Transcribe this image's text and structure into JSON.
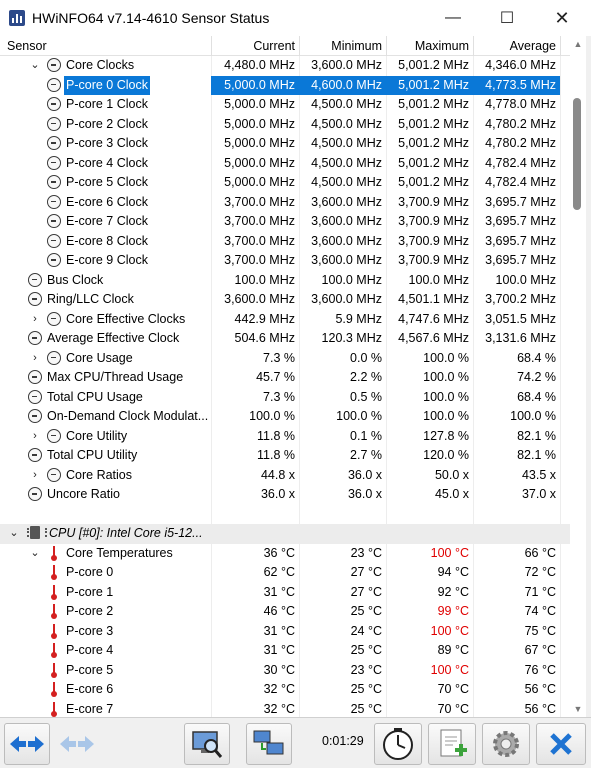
{
  "window": {
    "title": "HWiNFO64 v7.14-4610 Sensor Status"
  },
  "controls": {
    "minimize": "—",
    "maximize": "☐",
    "close": "✕"
  },
  "columns": {
    "sensor": "Sensor",
    "current": "Current",
    "minimum": "Minimum",
    "maximum": "Maximum",
    "average": "Average"
  },
  "rows": [
    {
      "label": "Core Clocks",
      "indent": 1,
      "expander": "⌄",
      "icon": "clock",
      "current": "4,480.0 MHz",
      "minimum": "3,600.0 MHz",
      "maximum": "5,001.2 MHz",
      "average": "4,346.0 MHz"
    },
    {
      "label": "P-core 0 Clock",
      "indent": 2,
      "icon": "clock",
      "selected": true,
      "current": "5,000.0 MHz",
      "minimum": "4,600.0 MHz",
      "maximum": "5,001.2 MHz",
      "average": "4,773.5 MHz"
    },
    {
      "label": "P-core 1 Clock",
      "indent": 2,
      "icon": "clock",
      "current": "5,000.0 MHz",
      "minimum": "4,500.0 MHz",
      "maximum": "5,001.2 MHz",
      "average": "4,778.0 MHz"
    },
    {
      "label": "P-core 2 Clock",
      "indent": 2,
      "icon": "clock",
      "current": "5,000.0 MHz",
      "minimum": "4,500.0 MHz",
      "maximum": "5,001.2 MHz",
      "average": "4,780.2 MHz"
    },
    {
      "label": "P-core 3 Clock",
      "indent": 2,
      "icon": "clock",
      "current": "5,000.0 MHz",
      "minimum": "4,500.0 MHz",
      "maximum": "5,001.2 MHz",
      "average": "4,780.2 MHz"
    },
    {
      "label": "P-core 4 Clock",
      "indent": 2,
      "icon": "clock",
      "current": "5,000.0 MHz",
      "minimum": "4,500.0 MHz",
      "maximum": "5,001.2 MHz",
      "average": "4,782.4 MHz"
    },
    {
      "label": "P-core 5 Clock",
      "indent": 2,
      "icon": "clock",
      "current": "5,000.0 MHz",
      "minimum": "4,500.0 MHz",
      "maximum": "5,001.2 MHz",
      "average": "4,782.4 MHz"
    },
    {
      "label": "E-core 6 Clock",
      "indent": 2,
      "icon": "clock",
      "current": "3,700.0 MHz",
      "minimum": "3,600.0 MHz",
      "maximum": "3,700.9 MHz",
      "average": "3,695.7 MHz"
    },
    {
      "label": "E-core 7 Clock",
      "indent": 2,
      "icon": "clock",
      "current": "3,700.0 MHz",
      "minimum": "3,600.0 MHz",
      "maximum": "3,700.9 MHz",
      "average": "3,695.7 MHz"
    },
    {
      "label": "E-core 8 Clock",
      "indent": 2,
      "icon": "clock",
      "current": "3,700.0 MHz",
      "minimum": "3,600.0 MHz",
      "maximum": "3,700.9 MHz",
      "average": "3,695.7 MHz"
    },
    {
      "label": "E-core 9 Clock",
      "indent": 2,
      "icon": "clock",
      "current": "3,700.0 MHz",
      "minimum": "3,600.0 MHz",
      "maximum": "3,700.9 MHz",
      "average": "3,695.7 MHz"
    },
    {
      "label": "Bus Clock",
      "indent": 0,
      "icon": "clock",
      "current": "100.0 MHz",
      "minimum": "100.0 MHz",
      "maximum": "100.0 MHz",
      "average": "100.0 MHz"
    },
    {
      "label": "Ring/LLC Clock",
      "indent": 0,
      "icon": "clock",
      "current": "3,600.0 MHz",
      "minimum": "3,600.0 MHz",
      "maximum": "4,501.1 MHz",
      "average": "3,700.2 MHz"
    },
    {
      "label": "Core Effective Clocks",
      "indent": 1,
      "expander": "›",
      "icon": "clock",
      "current": "442.9 MHz",
      "minimum": "5.9 MHz",
      "maximum": "4,747.6 MHz",
      "average": "3,051.5 MHz"
    },
    {
      "label": "Average Effective Clock",
      "indent": 0,
      "icon": "clock",
      "current": "504.6 MHz",
      "minimum": "120.3 MHz",
      "maximum": "4,567.6 MHz",
      "average": "3,131.6 MHz"
    },
    {
      "label": "Core Usage",
      "indent": 1,
      "expander": "›",
      "icon": "clock",
      "current": "7.3 %",
      "minimum": "0.0 %",
      "maximum": "100.0 %",
      "average": "68.4 %"
    },
    {
      "label": "Max CPU/Thread Usage",
      "indent": 0,
      "icon": "clock",
      "current": "45.7 %",
      "minimum": "2.2 %",
      "maximum": "100.0 %",
      "average": "74.2 %"
    },
    {
      "label": "Total CPU Usage",
      "indent": 0,
      "icon": "clock",
      "current": "7.3 %",
      "minimum": "0.5 %",
      "maximum": "100.0 %",
      "average": "68.4 %"
    },
    {
      "label": "On-Demand Clock Modulat...",
      "indent": 0,
      "icon": "clock",
      "current": "100.0 %",
      "minimum": "100.0 %",
      "maximum": "100.0 %",
      "average": "100.0 %"
    },
    {
      "label": "Core Utility",
      "indent": 1,
      "expander": "›",
      "icon": "clock",
      "current": "11.8 %",
      "minimum": "0.1 %",
      "maximum": "127.8 %",
      "average": "82.1 %"
    },
    {
      "label": "Total CPU Utility",
      "indent": 0,
      "icon": "clock",
      "current": "11.8 %",
      "minimum": "2.7 %",
      "maximum": "120.0 %",
      "average": "82.1 %"
    },
    {
      "label": "Core Ratios",
      "indent": 1,
      "expander": "›",
      "icon": "clock",
      "current": "44.8 x",
      "minimum": "36.0 x",
      "maximum": "50.0 x",
      "average": "43.5 x"
    },
    {
      "label": "Uncore Ratio",
      "indent": 0,
      "icon": "clock",
      "current": "36.0 x",
      "minimum": "36.0 x",
      "maximum": "45.0 x",
      "average": "37.0 x"
    },
    {
      "label": "",
      "indent": 0,
      "icon": "none",
      "current": "",
      "minimum": "",
      "maximum": "",
      "average": ""
    },
    {
      "label": "CPU [#0]: Intel Core i5-12...",
      "indent": 0,
      "expander": "⌄",
      "icon": "chip",
      "group": true,
      "current": "",
      "minimum": "",
      "maximum": "",
      "average": ""
    },
    {
      "label": "Core Temperatures",
      "indent": 1,
      "expander": "⌄",
      "icon": "therm",
      "current": "36 °C",
      "minimum": "23 °C",
      "maximum": "100 °C",
      "max_red": true,
      "average": "66 °C"
    },
    {
      "label": "P-core 0",
      "indent": 2,
      "icon": "therm",
      "current": "62 °C",
      "minimum": "27 °C",
      "maximum": "94 °C",
      "average": "72 °C"
    },
    {
      "label": "P-core 1",
      "indent": 2,
      "icon": "therm",
      "current": "31 °C",
      "minimum": "27 °C",
      "maximum": "92 °C",
      "average": "71 °C"
    },
    {
      "label": "P-core 2",
      "indent": 2,
      "icon": "therm",
      "current": "46 °C",
      "minimum": "25 °C",
      "maximum": "99 °C",
      "max_red": true,
      "average": "74 °C"
    },
    {
      "label": "P-core 3",
      "indent": 2,
      "icon": "therm",
      "current": "31 °C",
      "minimum": "24 °C",
      "maximum": "100 °C",
      "max_red": true,
      "average": "75 °C"
    },
    {
      "label": "P-core 4",
      "indent": 2,
      "icon": "therm",
      "current": "31 °C",
      "minimum": "25 °C",
      "maximum": "89 °C",
      "average": "67 °C"
    },
    {
      "label": "P-core 5",
      "indent": 2,
      "icon": "therm",
      "current": "30 °C",
      "minimum": "23 °C",
      "maximum": "100 °C",
      "max_red": true,
      "average": "76 °C"
    },
    {
      "label": "E-core 6",
      "indent": 2,
      "icon": "therm",
      "current": "32 °C",
      "minimum": "25 °C",
      "maximum": "70 °C",
      "average": "56 °C"
    },
    {
      "label": "E-core 7",
      "indent": 2,
      "icon": "therm",
      "current": "32 °C",
      "minimum": "25 °C",
      "maximum": "70 °C",
      "average": "56 °C"
    }
  ],
  "toolbar": {
    "timer": "0:01:29",
    "buttons": [
      "nav-arrows-icon",
      "nav-arrows-disabled-icon",
      "monitor-search-icon",
      "network-computers-icon",
      "clock-icon",
      "add-report-icon",
      "settings-gear-icon",
      "close-x-icon"
    ]
  },
  "colors": {
    "selection": "#0a78d7",
    "alarm": "#e00000",
    "group_bg": "#ececec"
  }
}
